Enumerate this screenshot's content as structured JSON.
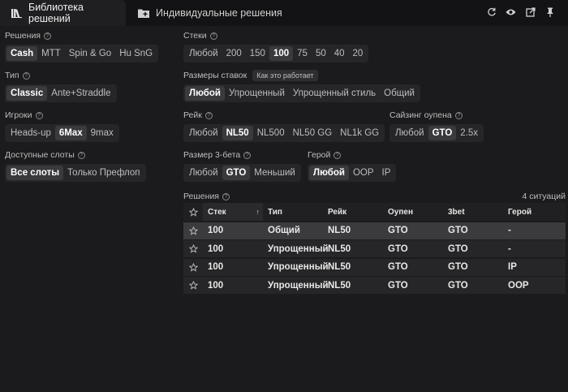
{
  "tabs": {
    "library": "Библиотека решений",
    "custom": "Индивидуальные решения"
  },
  "toolbar_icons": [
    "refresh-icon",
    "eye-icon",
    "external-link-icon",
    "pin-icon"
  ],
  "filters": {
    "solutions": {
      "label": "Решения",
      "options": [
        "Cash",
        "MTT",
        "Spin & Go",
        "Hu SnG"
      ],
      "selected": "Cash"
    },
    "type": {
      "label": "Тип",
      "options": [
        "Classic",
        "Ante+Straddle"
      ],
      "selected": "Classic"
    },
    "players": {
      "label": "Игроки",
      "options": [
        "Heads-up",
        "6Max",
        "9max"
      ],
      "selected": "6Max"
    },
    "slots": {
      "label": "Доступные слоты",
      "options": [
        "Все слоты",
        "Только Префлоп"
      ],
      "selected": "Все слоты"
    },
    "stacks": {
      "label": "Стеки",
      "options": [
        "Любой",
        "200",
        "150",
        "100",
        "75",
        "50",
        "40",
        "20"
      ],
      "selected": "100"
    },
    "bet_sizes": {
      "label": "Размеры ставок",
      "hint": "Как это работает",
      "options": [
        "Любой",
        "Упрощенный",
        "Упрощенный стиль",
        "Общий"
      ],
      "selected": "Любой"
    },
    "rake": {
      "label": "Рейк",
      "options": [
        "Любой",
        "NL50",
        "NL500",
        "NL50 GG",
        "NL1k GG"
      ],
      "selected": "NL50"
    },
    "open_sizing": {
      "label": "Сайзинг оупена",
      "options": [
        "Любой",
        "GTO",
        "2.5x"
      ],
      "selected": "GTO"
    },
    "threebet_size": {
      "label": "Размер 3-бета",
      "options": [
        "Любой",
        "GTO",
        "Меньший"
      ],
      "selected": "GTO"
    },
    "hero": {
      "label": "Герой",
      "options": [
        "Любой",
        "OOP",
        "IP"
      ],
      "selected": "Любой"
    }
  },
  "results": {
    "label": "Решения",
    "count": "4 ситуаций",
    "columns": [
      "Стек",
      "Тип",
      "Рейк",
      "Оупен",
      "3bet",
      "Герой"
    ],
    "sort_indicator": "↑",
    "rows": [
      {
        "stack": "100",
        "type": "Общий",
        "rake": "NL50",
        "open": "GTO",
        "threebet": "GTO",
        "hero": "-"
      },
      {
        "stack": "100",
        "type": "Упрощенный",
        "rake": "NL50",
        "open": "GTO",
        "threebet": "GTO",
        "hero": "-"
      },
      {
        "stack": "100",
        "type": "Упрощенный",
        "rake": "NL50",
        "open": "GTO",
        "threebet": "GTO",
        "hero": "IP"
      },
      {
        "stack": "100",
        "type": "Упрощенный",
        "rake": "NL50",
        "open": "GTO",
        "threebet": "GTO",
        "hero": "OOP"
      }
    ]
  },
  "colors": {
    "background": "#1b1b1d",
    "topbar": "#131315",
    "selected_option": "#3a3a3e",
    "highlighted_row": "#3b3b3e"
  }
}
